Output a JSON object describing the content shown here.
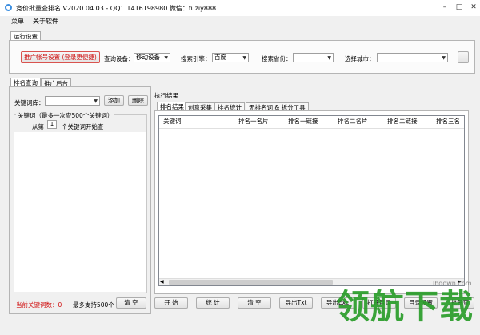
{
  "window": {
    "title": "竞价批量查排名 V2020.04.03 - QQ：1416198980  微信：fuziy888",
    "minimize": "–",
    "maximize": "□",
    "close": "✕"
  },
  "menu": [
    "菜单",
    "关于软件"
  ],
  "settings": {
    "group_title": "运行设置",
    "promo_button": "推广帐号设置 (登录更便捷)",
    "device_label": "查询设备：",
    "device_value": "移动设备",
    "engine_label": "搜索引擎：",
    "engine_value": "百度",
    "province_label": "搜索省份：",
    "province_value": "",
    "city_label": "选择城市：",
    "city_value": ""
  },
  "left": {
    "tabs": [
      "排名查询",
      "推广后台"
    ],
    "keyword_lib_label": "关键词库：",
    "keyword_lib_value": "",
    "add_button": "添加",
    "delete_button": "删除",
    "group_title": "关键词（最多一次查500个关键词）",
    "start_prefix": "从第",
    "start_value": "1",
    "start_suffix": "个关键词开始查",
    "current_count_label": "当前关键词数：0",
    "max_support": "最多支持500个",
    "clear_button": "清 空"
  },
  "results": {
    "group_title": "执行结果",
    "tabs": [
      "排名结果",
      "创意采集",
      "排名统计",
      "无排名词 & 拆分工具"
    ],
    "columns": [
      "关键词",
      "排名一名片",
      "排名一链接",
      "排名二名片",
      "排名二链接",
      "排名三名"
    ]
  },
  "bottom_buttons": [
    "开 始",
    "统 计",
    "清 空",
    "导出Txt",
    "导出Exc",
    "打开目录",
    "目录设置",
    "批量查"
  ],
  "watermark": {
    "text": "领航下载",
    "url": "lhdown.com"
  },
  "colors": {
    "promo_border": "#d9534f",
    "promo_text": "#d01010",
    "count_text": "#d01010",
    "watermark": "#2a9d2a"
  }
}
